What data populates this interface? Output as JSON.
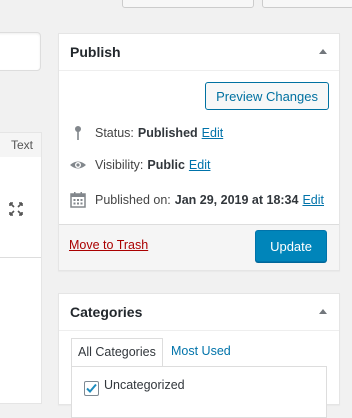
{
  "publish": {
    "title": "Publish",
    "preview_label": "Preview Changes",
    "status_label": "Status:",
    "status_value": "Published",
    "status_edit": "Edit",
    "visibility_label": "Visibility:",
    "visibility_value": "Public",
    "visibility_edit": "Edit",
    "published_label": "Published on:",
    "published_value": "Jan 29, 2019 at 18:34",
    "published_edit": "Edit",
    "trash_label": "Move to Trash",
    "update_label": "Update",
    "icons": [
      "pin-icon",
      "eye-icon",
      "calendar-icon",
      "collapse-arrow-icon"
    ]
  },
  "editor": {
    "text_tab": "Text",
    "icons": [
      "fullscreen-icon"
    ]
  },
  "categories": {
    "title": "Categories",
    "tab_all": "All Categories",
    "tab_most_used": "Most Used",
    "items": [
      {
        "label": "Uncategorized",
        "checked": true
      }
    ]
  },
  "colors": {
    "primary": "#0085ba",
    "link": "#0073aa",
    "delete": "#a00",
    "background": "#f1f1f1"
  }
}
